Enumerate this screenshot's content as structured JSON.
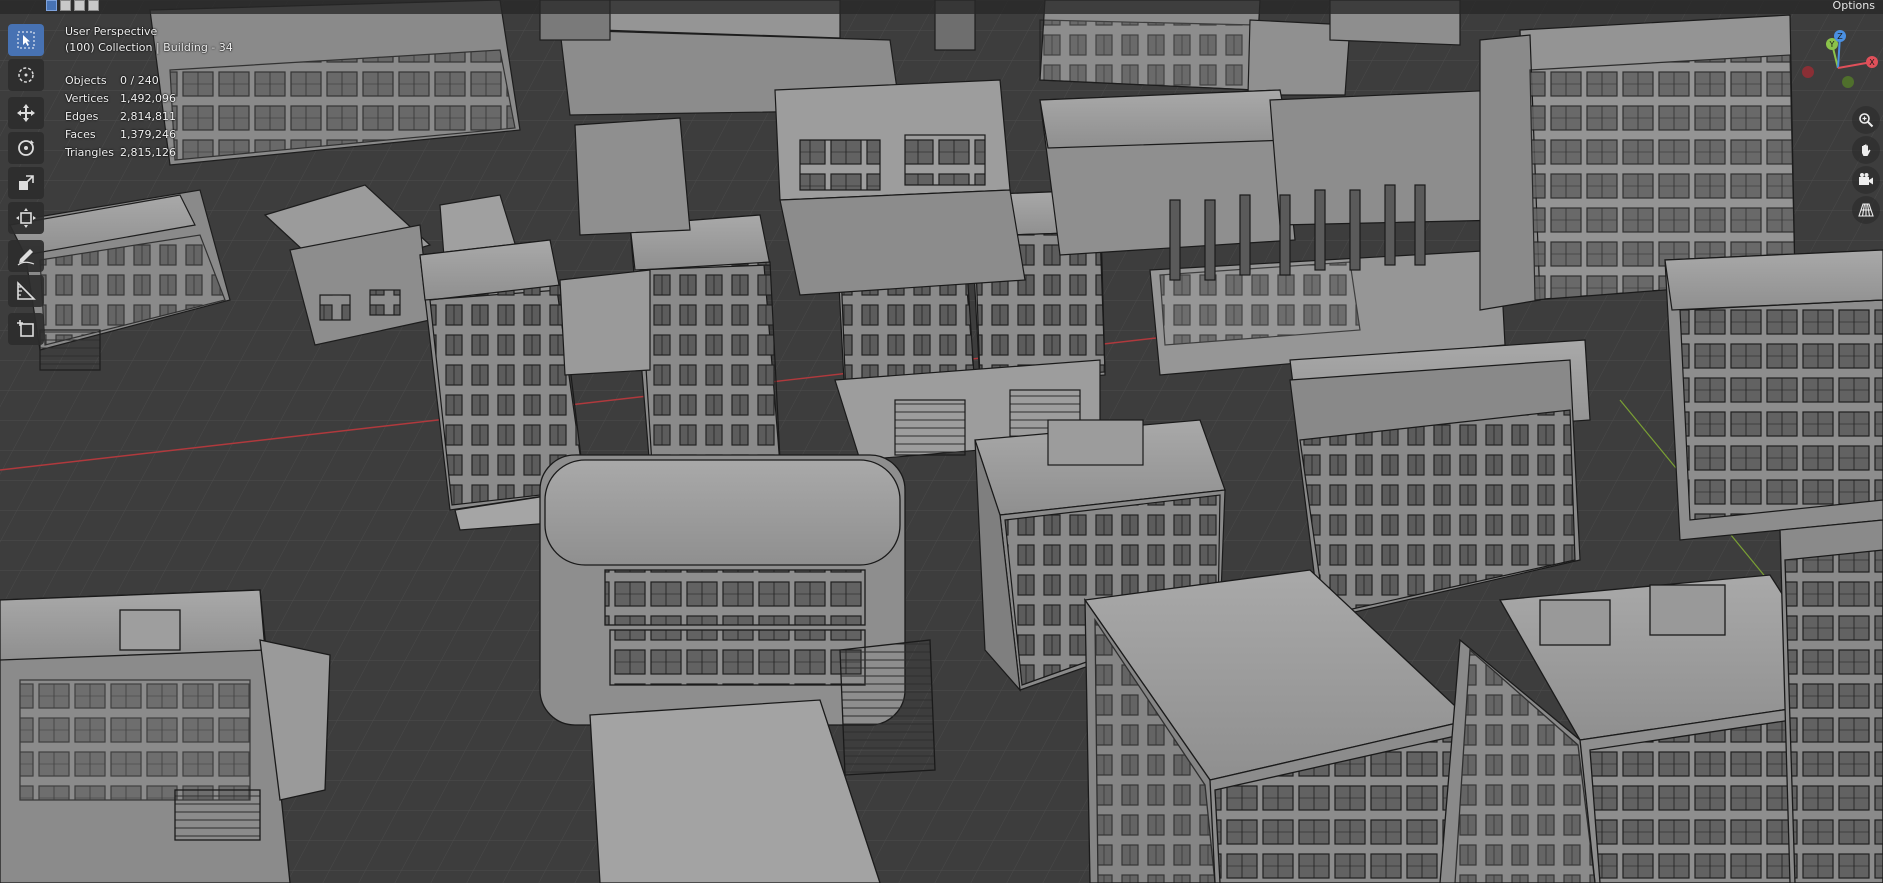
{
  "header": {
    "options_label": "Options",
    "mode_icons": [
      "select-box-icon",
      "select-extend-icon",
      "select-subtract-icon",
      "select-intersect-icon"
    ]
  },
  "viewport": {
    "view_name": "User Perspective",
    "context_line": "(100) Collection | Building - 34",
    "background_color": "#3d3d3d",
    "grid_color": "#4a4a4a",
    "x_axis_color": "#b0393d",
    "y_axis_color": "#7aa034"
  },
  "stats": [
    {
      "label": "Objects",
      "value": "0 / 240"
    },
    {
      "label": "Vertices",
      "value": "1,492,096"
    },
    {
      "label": "Edges",
      "value": "2,814,811"
    },
    {
      "label": "Faces",
      "value": "1,379,246"
    },
    {
      "label": "Triangles",
      "value": "2,815,126"
    }
  ],
  "toolbar": {
    "tools": [
      {
        "name": "select-box",
        "icon": "cursor-arrow-icon",
        "active": true
      },
      {
        "name": "cursor",
        "icon": "cursor-target-icon",
        "active": false
      },
      {
        "name": "move",
        "icon": "move-arrows-icon",
        "active": false
      },
      {
        "name": "rotate",
        "icon": "rotate-icon",
        "active": false
      },
      {
        "name": "scale",
        "icon": "scale-icon",
        "active": false
      },
      {
        "name": "transform",
        "icon": "transform-icon",
        "active": false
      },
      {
        "name": "annotate",
        "icon": "pencil-icon",
        "active": false
      },
      {
        "name": "measure",
        "icon": "ruler-icon",
        "active": false
      },
      {
        "name": "add-cube",
        "icon": "add-cube-icon",
        "active": false
      }
    ]
  },
  "gizmo": {
    "axis_labels": [
      "Y",
      "Z",
      "X"
    ],
    "axis_colors": {
      "x": "#e0505a",
      "y": "#8bc34a",
      "z": "#4a90e2"
    },
    "nav_buttons": [
      "zoom-icon",
      "pan-hand-icon",
      "camera-icon",
      "perspective-grid-icon"
    ]
  }
}
